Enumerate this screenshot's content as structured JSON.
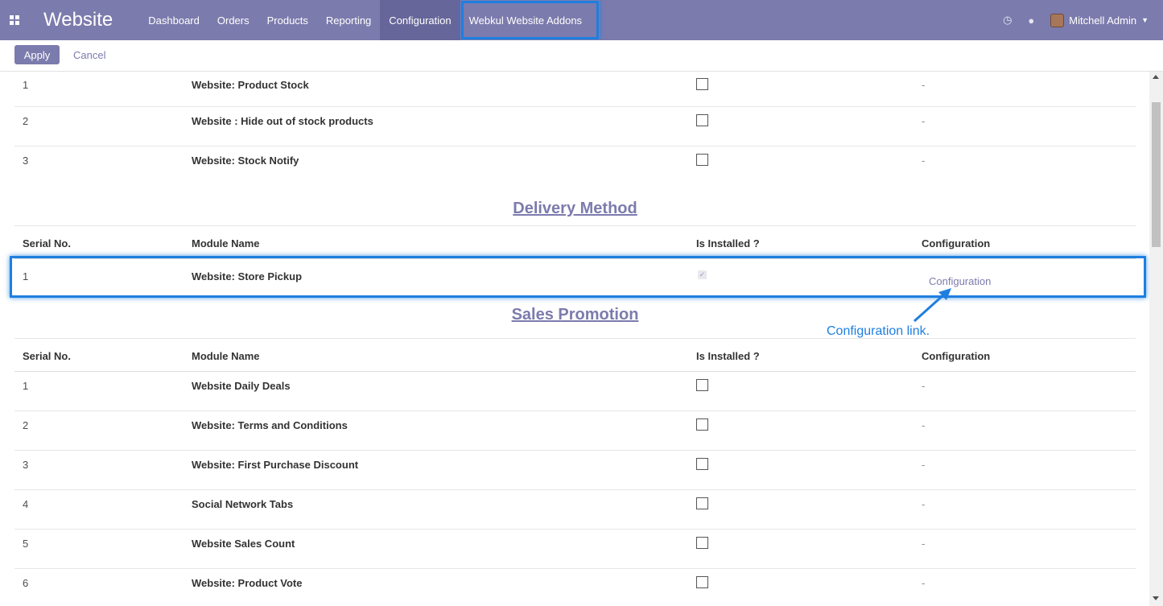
{
  "navbar": {
    "app_name": "Website",
    "menu": [
      {
        "label": "Dashboard"
      },
      {
        "label": "Orders"
      },
      {
        "label": "Products"
      },
      {
        "label": "Reporting"
      },
      {
        "label": "Configuration"
      },
      {
        "label": "Webkul Website Addons"
      }
    ],
    "user": "Mitchell Admin",
    "colors": {
      "bar": "#7c7bad",
      "highlight": "#1e7fe0"
    }
  },
  "control": {
    "apply": "Apply",
    "cancel": "Cancel"
  },
  "stock": {
    "rows": [
      {
        "serial": "1",
        "name": "Website: Product Stock",
        "config": "-"
      },
      {
        "serial": "2",
        "name": "Website : Hide out of stock products",
        "config": "-"
      },
      {
        "serial": "3",
        "name": "Website: Stock Notify",
        "config": "-"
      }
    ]
  },
  "headers": {
    "serial": "Serial No.",
    "module": "Module Name",
    "installed": "Is Installed ?",
    "config": "Configuration"
  },
  "delivery": {
    "title": "Delivery Method",
    "rows": [
      {
        "serial": "1",
        "name": "Website: Store Pickup",
        "installed": true,
        "config": "Configuration"
      }
    ]
  },
  "annotation": {
    "text": "Configuration link."
  },
  "promotion": {
    "title": "Sales Promotion",
    "rows": [
      {
        "serial": "1",
        "name": "Website Daily Deals",
        "config": "-"
      },
      {
        "serial": "2",
        "name": "Website: Terms and Conditions",
        "config": "-"
      },
      {
        "serial": "3",
        "name": "Website: First Purchase Discount",
        "config": "-"
      },
      {
        "serial": "4",
        "name": "Social Network Tabs",
        "config": "-"
      },
      {
        "serial": "5",
        "name": "Website Sales Count",
        "config": "-"
      },
      {
        "serial": "6",
        "name": "Website: Product Vote",
        "config": "-"
      }
    ]
  }
}
